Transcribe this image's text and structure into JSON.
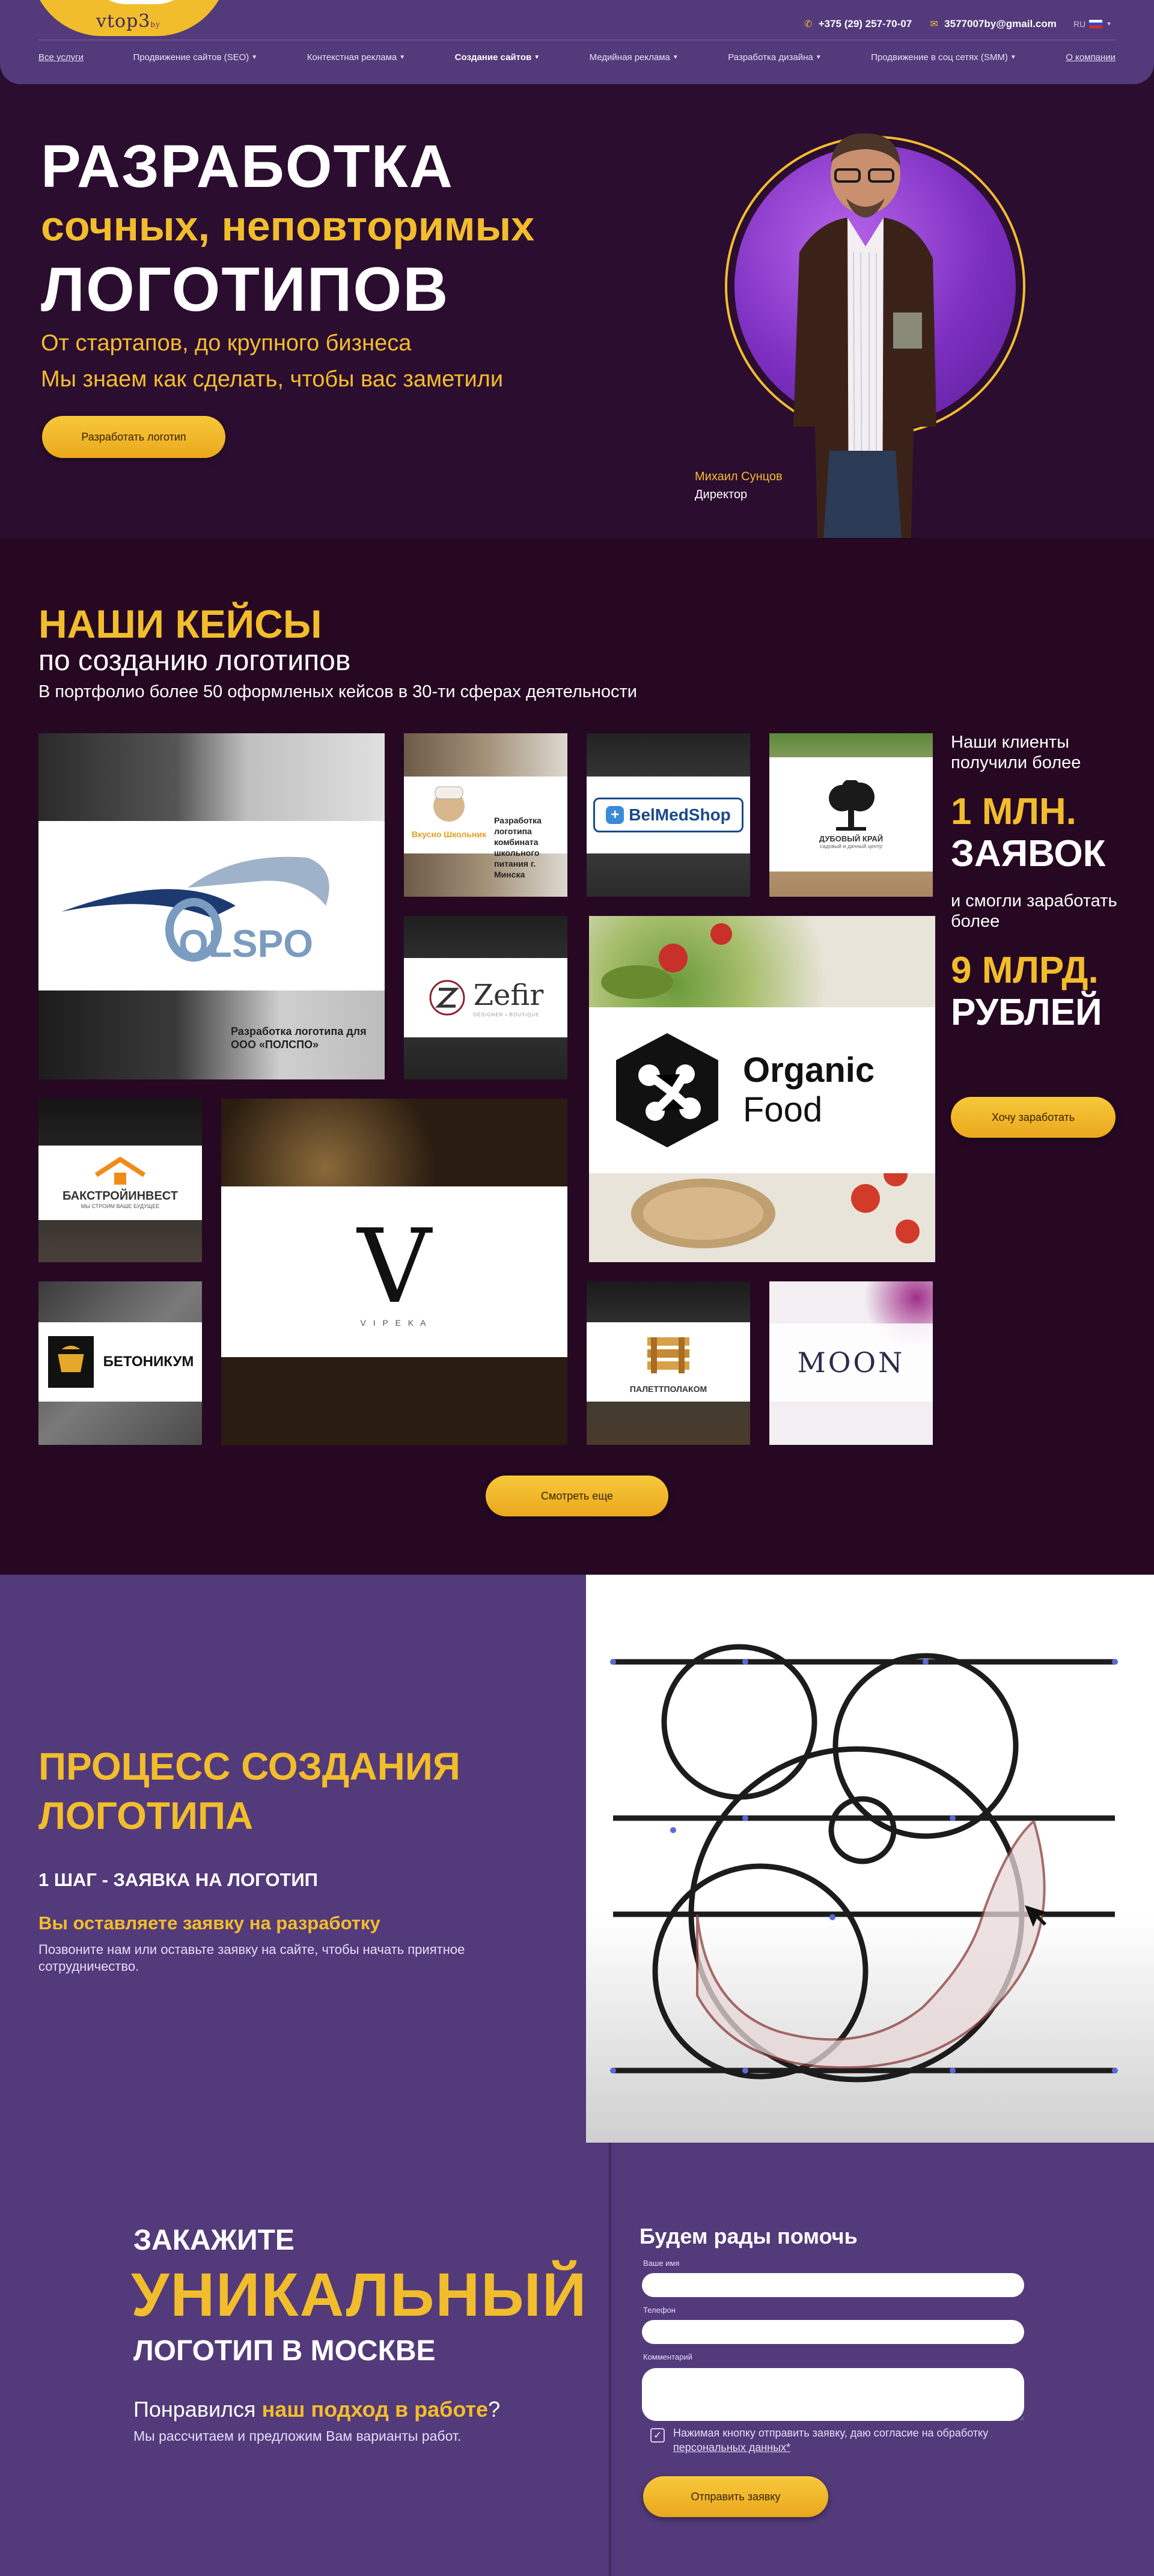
{
  "header": {
    "logo_text": "vtop3",
    "logo_suffix": "by",
    "phone": "+375 (29) 257-70-07",
    "email": "3577007by@gmail.com",
    "lang": "RU",
    "nav": [
      "Все услуги",
      "Продвижение сайтов (SEO)",
      "Контекстная реклама",
      "Создание сайтов",
      "Медийная реклама",
      "Разработка дизайна",
      "Продвижение в соц сетях (SMM)",
      "О компании"
    ]
  },
  "hero": {
    "title_1": "РАЗРАБОТКА",
    "title_2": "сочных, неповторимых",
    "title_3": "ЛОГОТИПОВ",
    "line_1": "От стартапов, до крупного бизнеса",
    "line_2": "Мы знаем как сделать, чтобы вас заметили",
    "cta": "Разработать логотип",
    "person_name": "Михаил Сунцов",
    "person_role": "Директор"
  },
  "cases": {
    "heading": "НАШИ КЕЙСЫ",
    "subheading": "по созданию логотипов",
    "description": "В портфолио более 50 оформленых кейсов в 30-ти сферах деятельности",
    "tiles": {
      "polspo": {
        "logo": "OLSPO",
        "caption": "Разработка логотипа для ООО «ПОЛСПО»"
      },
      "shkola": {
        "logo": "Вкусно Школьник",
        "caption": "Разработка логотипа комбината школьного питания г. Минска"
      },
      "belmed": {
        "logo": "BelMedShop"
      },
      "dub": {
        "logo": "ДУБОВЫЙ КРАЙ",
        "tagline": "садовый и дачный центр"
      },
      "zefir": {
        "logo": "Zefir",
        "tagline": "DESIGNER • BOUTIQUE"
      },
      "organic_1": "Organic",
      "organic_2": "Food",
      "bakstroy": {
        "logo": "БАКСТРОЙИНВЕСТ",
        "tagline": "МЫ СТРОИМ ВАШЕ БУДУЩЕЕ"
      },
      "vipeka": {
        "logo": "V",
        "tagline": "V I P E K A"
      },
      "betonikum": {
        "logo": "БЕТОНИКУМ"
      },
      "palett": {
        "logo": "ПАЛЕТТПОЛАКОМ"
      },
      "moon": {
        "logo": "MOON"
      }
    },
    "stats": {
      "t1": "Наши клиенты получили более",
      "big1": "1 МЛН.",
      "big1b": "ЗАЯВОК",
      "t2": "и смогли заработать более",
      "big2": "9 МЛРД.",
      "big2b": "РУБЛЕЙ",
      "cta": "Хочу заработать"
    },
    "more": "Смотреть еще"
  },
  "process": {
    "heading_1": "ПРОЦЕСС СОЗДАНИЯ",
    "heading_2": "ЛОГОТИПА",
    "step": "1 ШАГ - ЗАЯВКА НА ЛОГОТИП",
    "step_title": "Вы оставляете заявку на разработку",
    "step_text": "Позвоните нам или оставьте заявку на сайте, чтобы начать приятное сотрудничество."
  },
  "order": {
    "line_1": "ЗАКАЖИТЕ",
    "line_2": "УНИКАЛЬНЫЙ",
    "line_3": "ЛОГОТИП В МОСКВЕ",
    "line_4_pre": "Понравился ",
    "line_4_hl": "наш подход в работе",
    "line_4_post": "?",
    "line_5": "Мы рассчитаем и предложим Вам варианты работ.",
    "form_title": "Будем рады помочь",
    "label_name": "Ваше имя",
    "label_phone": "Телефон",
    "label_comment": "Комментарий",
    "consent_text": "Нажимая кнопку отправить заявку, даю согласие на обработку",
    "consent_link": "персональных данных*",
    "submit": "Отправить заявку"
  },
  "colors": {
    "accent": "#f2bd2c",
    "header_bg": "#533a7a",
    "hero_bg": "#2b0d30",
    "cases_bg": "#260823"
  }
}
